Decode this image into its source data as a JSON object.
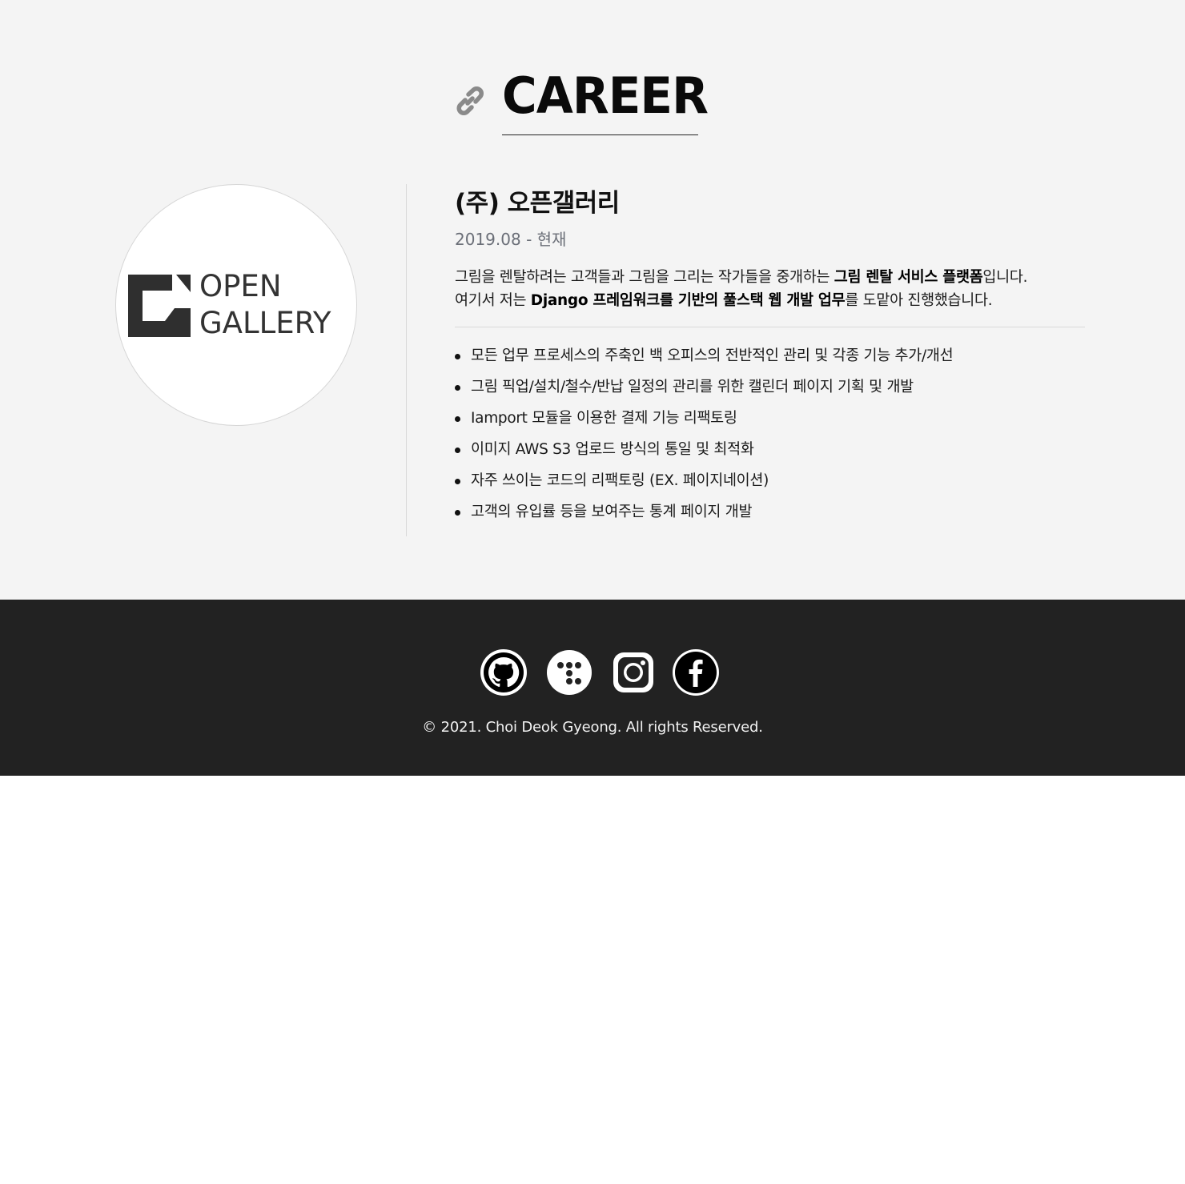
{
  "career": {
    "heading": "CAREER",
    "header_icon": "link-icon",
    "company": {
      "logo_text_line1": "OPEN",
      "logo_text_line2": "GALLERY",
      "name": "(주) 오픈갤러리",
      "period": "2019.08 - 현재",
      "description_line1_pre": "그림을 렌탈하려는 고객들과 그림을 그리는 작가들을 중개하는 ",
      "description_line1_bold": "그림 렌탈 서비스 플랫폼",
      "description_line1_post": "입니다.",
      "description_line2_pre": "여기서 저는 ",
      "description_line2_bold": "Django 프레임워크를 기반의 풀스택 웹 개발 업무",
      "description_line2_post": "를 도맡아 진행했습니다.",
      "tasks": [
        "모든 업무 프로세스의 주축인 백 오피스의 전반적인 관리 및 각종 기능 추가/개선",
        "그림 픽업/설치/철수/반납 일정의 관리를 위한 캘린더 페이지 기획 및 개발",
        "Iamport 모듈을 이용한 결제 기능 리팩토링",
        "이미지 AWS S3 업로드 방식의 통일 및 최적화",
        "자주 쓰이는 코드의 리팩토링 (EX. 페이지네이션)",
        "고객의 유입률 등을 보여주는 통계 페이지 개발"
      ]
    }
  },
  "footer": {
    "social_icons": [
      "github-icon",
      "tistory-icon",
      "instagram-icon",
      "facebook-icon"
    ],
    "copyright": "© 2021. Choi Deok Gyeong. All rights Reserved."
  },
  "colors": {
    "section_bg": "#f4f4f4",
    "footer_bg": "#222222",
    "period_text": "#6b6f78",
    "link_icon": "#8a8a8a"
  }
}
